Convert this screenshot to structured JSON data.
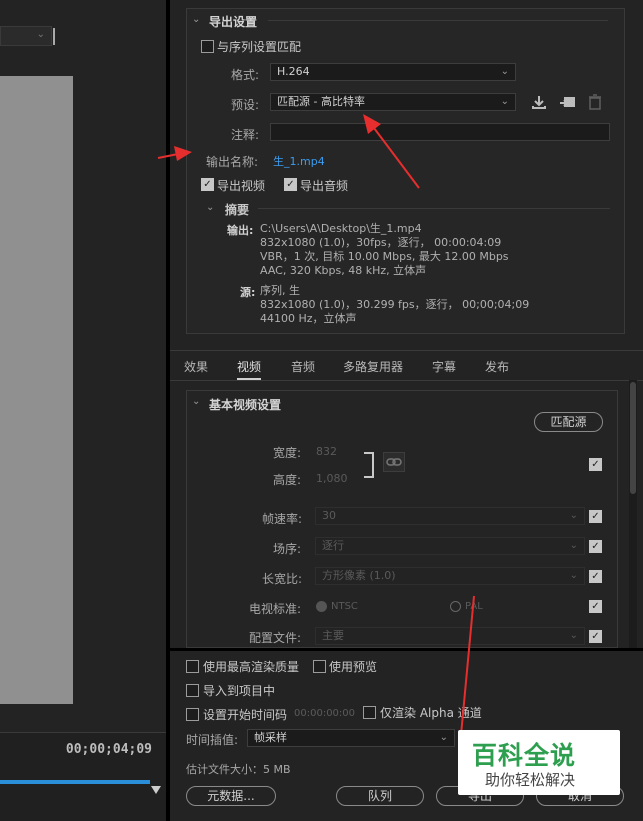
{
  "left": {
    "timecode": "00;00;04;09"
  },
  "export": {
    "section_title": "导出设置",
    "match_sequence": "与序列设置匹配",
    "format_label": "格式:",
    "format_value": "H.264",
    "preset_label": "预设:",
    "preset_value": "匹配源 - 高比特率",
    "comment_label": "注释:",
    "comment_value": "",
    "output_name_label": "输出名称:",
    "output_name_value": "生_1.mp4",
    "export_video": "导出视频",
    "export_audio": "导出音频"
  },
  "summary": {
    "title": "摘要",
    "output_label": "输出:",
    "output_lines": [
      "C:\\Users\\A\\Desktop\\生_1.mp4",
      "832x1080 (1.0)，30fps，逐行， 00:00:04:09",
      "VBR，1 次, 目标 10.00 Mbps, 最大 12.00 Mbps",
      "AAC, 320 Kbps, 48 kHz, 立体声"
    ],
    "source_label": "源:",
    "source_lines": [
      "序列, 生",
      "832x1080 (1.0)，30.299 fps，逐行， 00;00;04;09",
      "44100 Hz，立体声"
    ]
  },
  "tabs": [
    "效果",
    "视频",
    "音频",
    "多路复用器",
    "字幕",
    "发布"
  ],
  "active_tab": "视频",
  "video": {
    "section_title": "基本视频设置",
    "match_source_button": "匹配源",
    "width_label": "宽度:",
    "width_value": "832",
    "height_label": "高度:",
    "height_value": "1,080",
    "framerate_label": "帧速率:",
    "framerate_value": "30",
    "field_order_label": "场序:",
    "field_order_value": "逐行",
    "aspect_label": "长宽比:",
    "aspect_value": "方形像素 (1.0)",
    "tv_standard_label": "电视标准:",
    "ntsc": "NTSC",
    "pal": "PAL",
    "profile_label": "配置文件:",
    "profile_value": "主要"
  },
  "bottom": {
    "max_render": "使用最高渲染质量",
    "use_previews": "使用预览",
    "import_project": "导入到项目中",
    "set_start_timecode": "设置开始时间码",
    "start_timecode_value": "00:00:00:00",
    "render_alpha": "仅渲染 Alpha 通道",
    "interpolation_label": "时间插值:",
    "interpolation_value": "帧采样",
    "file_size": "估计文件大小：5 MB",
    "metadata_button": "元数据...",
    "queue_button": "队列",
    "export_button": "导出",
    "cancel_button": "取消"
  },
  "watermark": {
    "title": "百科全说",
    "subtitle": "助你轻松解决"
  },
  "colors": {
    "link": "#3b9cf0",
    "arrow": "#e62e2e",
    "watermark_green": "#2e9e4f"
  }
}
